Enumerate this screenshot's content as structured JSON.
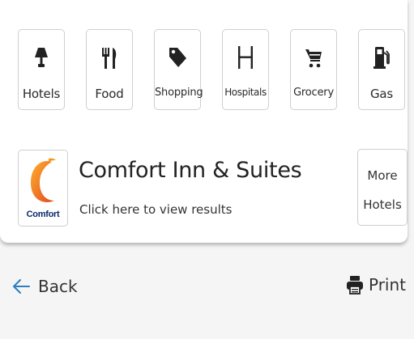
{
  "categories": [
    {
      "label": "Hotels",
      "icon": "lamp-icon"
    },
    {
      "label": "Food",
      "icon": "fork-knife-icon"
    },
    {
      "label": "Shopping",
      "icon": "price-tag-icon"
    },
    {
      "label": "Hospitals",
      "icon": "hospital-h-icon"
    },
    {
      "label": "Grocery",
      "icon": "shopping-cart-icon"
    },
    {
      "label": "Gas",
      "icon": "gas-pump-icon"
    }
  ],
  "hotel": {
    "logo_text": "Comfort",
    "name": "Comfort Inn & Suites",
    "subtitle": "Click here to view results"
  },
  "more_button": {
    "line1": "More",
    "line2": "Hotels"
  },
  "footer": {
    "back_label": "Back",
    "print_label": "Print"
  },
  "colors": {
    "accent_blue": "#2e7fc0",
    "logo_orange": "#f39a1e",
    "logo_red": "#e2452a",
    "brand_navy": "#0a2a6b"
  }
}
